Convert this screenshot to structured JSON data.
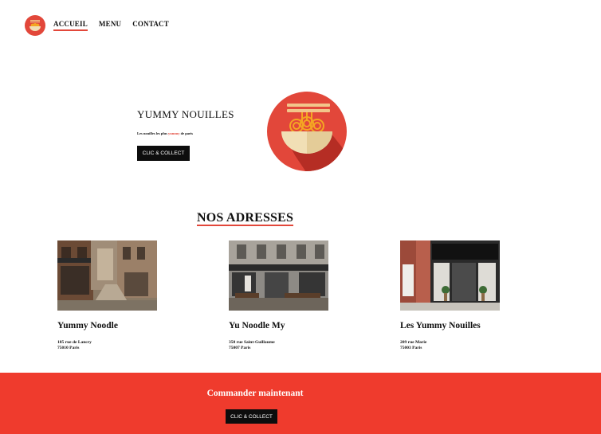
{
  "nav": {
    "logo_icon": "noodle-bowl-icon",
    "links": [
      {
        "label": "ACCUEIL",
        "active": true
      },
      {
        "label": "MENU",
        "active": false
      },
      {
        "label": "CONTACT",
        "active": false
      }
    ]
  },
  "hero": {
    "title": "YUMMY NOUILLES",
    "subtitle_before": "Les nouilles les plus ",
    "subtitle_accent": "yummy",
    "subtitle_after": " de paris",
    "button_label": "CLIC & COLLECT",
    "image_icon": "noodle-bowl-illustration"
  },
  "addresses": {
    "title": "NOS ADRESSES",
    "cards": [
      {
        "name": "Yummy Noodle",
        "street": "185 rue de Lancry",
        "city": "75010 Paris"
      },
      {
        "name": "Yu Noodle My",
        "street": "350 rue Saint-Guillaume",
        "city": "75007 Paris"
      },
      {
        "name": "Les Yummy Nouilles",
        "street": "209 rue Marie",
        "city": "75003 Paris"
      }
    ]
  },
  "footer": {
    "title": "Commander maintenant",
    "button_label": "CLIC & COLLECT"
  },
  "colors": {
    "accent": "#e2473a",
    "footer_bg": "#ef3b2d",
    "button_bg": "#0d0d0d"
  }
}
